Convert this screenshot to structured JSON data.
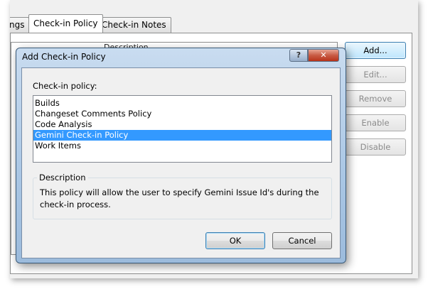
{
  "background_window": {
    "tabs": [
      {
        "label": "ngs"
      },
      {
        "label": "Check-in Policy",
        "active": true
      },
      {
        "label": "Check-in Notes"
      }
    ],
    "list_header": "Description",
    "side_buttons": [
      {
        "label": "Add...",
        "enabled": true
      },
      {
        "label": "Edit...",
        "enabled": false
      },
      {
        "label": "Remove",
        "enabled": false
      },
      {
        "label": "Enable",
        "enabled": false
      },
      {
        "label": "Disable",
        "enabled": false
      }
    ]
  },
  "dialog": {
    "title": "Add Check-in Policy",
    "help_glyph": "?",
    "close_glyph": "✕",
    "policy_label": "Check-in policy:",
    "policies": [
      {
        "label": "Builds",
        "selected": false
      },
      {
        "label": "Changeset Comments Policy",
        "selected": false
      },
      {
        "label": "Code Analysis",
        "selected": false
      },
      {
        "label": "Gemini Check-in Policy",
        "selected": true
      },
      {
        "label": "Work Items",
        "selected": false
      }
    ],
    "description_label": "Description",
    "description_text": "This policy will allow the user to specify Gemini Issue Id's during the check-in process.",
    "ok_label": "OK",
    "cancel_label": "Cancel"
  },
  "colors": {
    "selection": "#3399ff",
    "dialog_frame": "#a9c6e4",
    "close_button": "#c85b44"
  }
}
